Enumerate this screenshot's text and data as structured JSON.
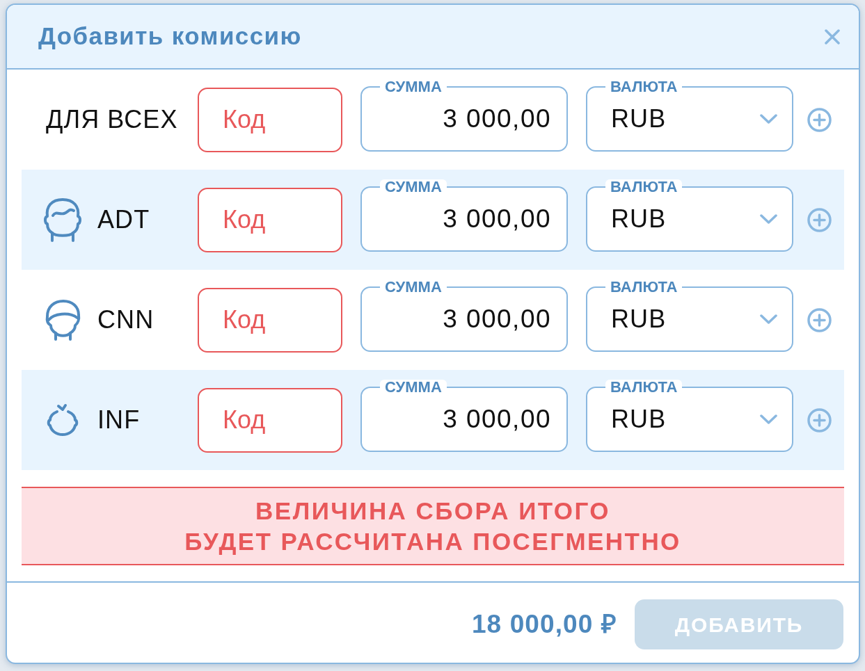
{
  "dialog": {
    "title": "Добавить комиссию"
  },
  "rows": [
    {
      "kind": "all",
      "label": "ДЛЯ ВСЕХ",
      "code": {
        "placeholder": "Код",
        "invalid": true
      },
      "amount": {
        "label": "СУММА",
        "value": "3 000,00"
      },
      "currency": {
        "label": "ВАЛЮТА",
        "value": "RUB"
      }
    },
    {
      "kind": "adult",
      "label": "ADT",
      "code": {
        "placeholder": "Код",
        "invalid": true
      },
      "amount": {
        "label": "СУММА",
        "value": "3 000,00"
      },
      "currency": {
        "label": "ВАЛЮТА",
        "value": "RUB"
      }
    },
    {
      "kind": "child",
      "label": "CNN",
      "code": {
        "placeholder": "Код",
        "invalid": true
      },
      "amount": {
        "label": "СУММА",
        "value": "3 000,00"
      },
      "currency": {
        "label": "ВАЛЮТА",
        "value": "RUB"
      }
    },
    {
      "kind": "infant",
      "label": "INF",
      "code": {
        "placeholder": "Код",
        "invalid": true
      },
      "amount": {
        "label": "СУММА",
        "value": "3 000,00"
      },
      "currency": {
        "label": "ВАЛЮТА",
        "value": "RUB"
      }
    }
  ],
  "notice": {
    "lines": [
      "ВЕЛИЧИНА СБОРА ИТОГО",
      "БУДЕТ РАССЧИТАНА ПОСЕГМЕНТНО"
    ]
  },
  "footer": {
    "total": "18 000,00 ₽",
    "submit": {
      "label": "ДОБАВИТЬ",
      "disabled": true
    }
  }
}
